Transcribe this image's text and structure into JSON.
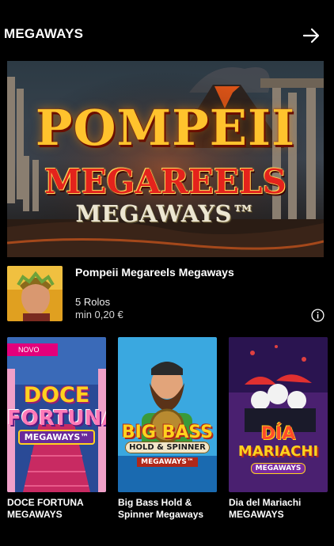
{
  "section": {
    "title": "MEGAWAYS"
  },
  "hero": {
    "logo_line1": "POMPEII",
    "logo_line2": "MEGAREELS",
    "logo_line3": "MEGAWAYS™"
  },
  "featured": {
    "name": "Pompeii Megareels Megaways",
    "reels": "5 Rolos",
    "min_bet": "min 0,20 €"
  },
  "games": [
    {
      "badge": "NOVO",
      "logo_a": "DOCE",
      "logo_b": "FORTUNA",
      "logo_c": "MEGAWAYS™",
      "label": "DOCE FORTUNA MEGAWAYS"
    },
    {
      "logo_a": "BIG BASS",
      "logo_b": "HOLD & SPINNER",
      "logo_c": "MEGAWAYS™",
      "label": "Big Bass Hold & Spinner Megaways"
    },
    {
      "logo_a": "DÍA",
      "logo_b": "MARIACHI",
      "logo_c": "MEGAWAYS",
      "label": "Dia del Mariachi MEGAWAYS"
    }
  ],
  "colors": {
    "background": "#000000",
    "badge": "#e3007b",
    "text": "#ffffff"
  }
}
